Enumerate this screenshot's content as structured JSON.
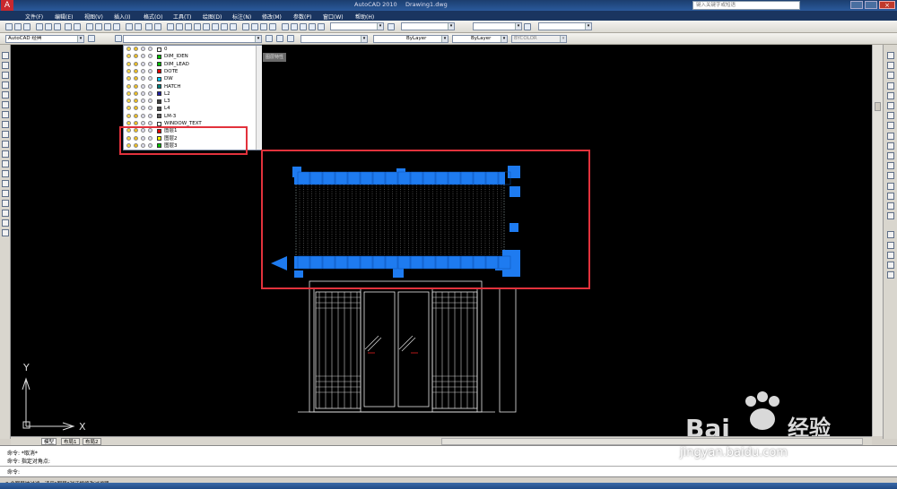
{
  "window": {
    "title": "AutoCAD 2010",
    "doc": "Drawing1.dwg",
    "search_placeholder": "键入关键字或短语"
  },
  "menus": [
    "文件(F)",
    "编辑(E)",
    "视图(V)",
    "插入(I)",
    "格式(O)",
    "工具(T)",
    "绘图(D)",
    "标注(N)",
    "修改(M)",
    "参数(P)",
    "窗口(W)",
    "帮助(H)"
  ],
  "toolbar": {
    "workspace": "AutoCAD 经典",
    "layer_current": "",
    "linetype": "ByLayer",
    "lineweight": "ByLayer",
    "plotstyle": "BYCOLOR",
    "filter_hint": "图层特性"
  },
  "layers": [
    {
      "name": "0",
      "color": "#ffffff"
    },
    {
      "name": "DIM_IDEN",
      "color": "#00c000"
    },
    {
      "name": "DIM_LEAD",
      "color": "#00c000"
    },
    {
      "name": "DOTE",
      "color": "#e00000"
    },
    {
      "name": "DW",
      "color": "#00c8ff"
    },
    {
      "name": "HATCH",
      "color": "#008080"
    },
    {
      "name": "L2",
      "color": "#2020a0"
    },
    {
      "name": "L3",
      "color": "#404040"
    },
    {
      "name": "L4",
      "color": "#505050"
    },
    {
      "name": "LM-3",
      "color": "#606060"
    },
    {
      "name": "WINDOW_TEXT",
      "color": "#ffffff"
    },
    {
      "name": "图层1",
      "color": "#e00000"
    },
    {
      "name": "图层2",
      "color": "#ffff00"
    },
    {
      "name": "图层3",
      "color": "#00c000"
    }
  ],
  "ucs": {
    "y": "Y",
    "x": "X"
  },
  "tabs": [
    "模型",
    "布局1",
    "布局2"
  ],
  "command": {
    "lines": [
      "命令: *取消*",
      "命令: 指定对角点:",
      "命令:"
    ]
  },
  "status": {
    "text": "3 个图层被过滤。请用“图层”对话框修改过滤器。"
  },
  "watermark": {
    "brand": "Bai",
    "brand2": "du",
    "cn": "经验",
    "url": "jingyan.baidu.com"
  },
  "colors": {
    "selection": "#1e7bf0",
    "highlight": "#e2323c",
    "canvas": "#000000"
  }
}
